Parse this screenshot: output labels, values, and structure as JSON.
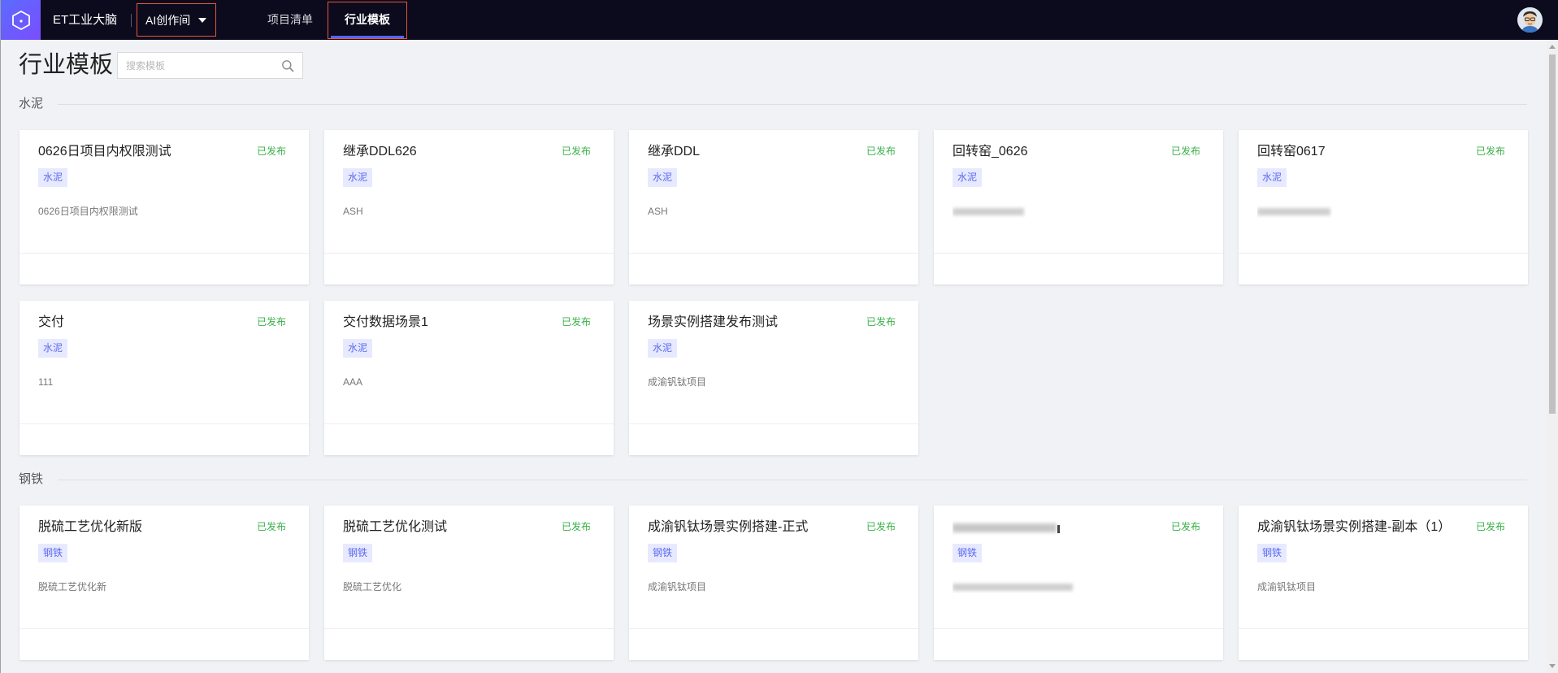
{
  "topbar": {
    "app_name": "ET工业大脑",
    "ai_menu_label": "AI创作间",
    "nav": [
      {
        "label": "项目清单"
      },
      {
        "label": "行业模板"
      }
    ],
    "user_avatar": "avatar-icon"
  },
  "header": {
    "title": "行业模板",
    "search_placeholder": "搜索模板",
    "search_icon": "search-icon"
  },
  "colors": {
    "topbar_bg": "#0c0b1d",
    "accent": "#5b62ff",
    "status_published": "#3bb04a",
    "tag_bg": "#e7eaff",
    "tag_text": "#5b68f0",
    "highlight_border": "#e8553a"
  },
  "sections": [
    {
      "name": "水泥",
      "cards": [
        {
          "title": "0626日项目内权限测试",
          "status": "已发布",
          "tag": "水泥",
          "desc": "0626日项目内权限测试"
        },
        {
          "title": "继承DDL626",
          "status": "已发布",
          "tag": "水泥",
          "desc": "ASH"
        },
        {
          "title": "继承DDL",
          "status": "已发布",
          "tag": "水泥",
          "desc": "ASH"
        },
        {
          "title": "回转窑_0626",
          "status": "已发布",
          "tag": "水泥",
          "desc": "",
          "desc_blurred": true
        },
        {
          "title": "回转窑0617",
          "status": "已发布",
          "tag": "水泥",
          "desc": "",
          "desc_blurred": true
        },
        {
          "title": "交付",
          "status": "已发布",
          "tag": "水泥",
          "desc": "111"
        },
        {
          "title": "交付数据场景1",
          "status": "已发布",
          "tag": "水泥",
          "desc": "AAA"
        },
        {
          "title": "场景实例搭建发布测试",
          "status": "已发布",
          "tag": "水泥",
          "desc": "成渝钒钛项目"
        }
      ]
    },
    {
      "name": "钢铁",
      "cards": [
        {
          "title": "脱硫工艺优化新版",
          "status": "已发布",
          "tag": "钢铁",
          "desc": "脱硫工艺优化新"
        },
        {
          "title": "脱硫工艺优化测试",
          "status": "已发布",
          "tag": "钢铁",
          "desc": "脱硫工艺优化"
        },
        {
          "title": "成渝钒钛场景实例搭建-正式",
          "status": "已发布",
          "tag": "钢铁",
          "desc": "成渝钒钛项目"
        },
        {
          "title": "",
          "title_blurred": true,
          "status": "已发布",
          "tag": "钢铁",
          "desc": "",
          "desc_blurred": true
        },
        {
          "title": "成渝钒钛场景实例搭建-副本（1）",
          "status": "已发布",
          "tag": "钢铁",
          "desc": "成渝钒钛项目"
        }
      ]
    }
  ]
}
